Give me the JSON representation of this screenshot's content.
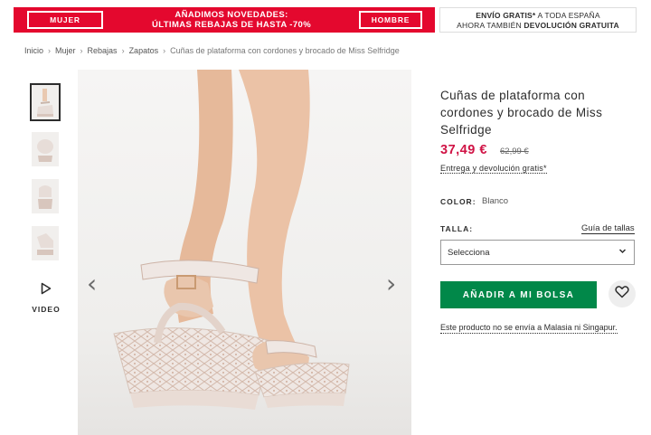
{
  "promo": {
    "women_label": "MUJER",
    "men_label": "HOMBRE",
    "line1": "AÑADIMOS NOVEDADES:",
    "line2": "ÚLTIMAS REBAJAS DE HASTA -70%",
    "color": "#e4082e"
  },
  "shipping": {
    "line1_bold": "ENVÍO GRATIS*",
    "line1_rest": " A TODA ESPAÑA",
    "line2_rest": "AHORA TAMBIÉN ",
    "line2_bold": "DEVOLUCIÓN GRATUITA"
  },
  "breadcrumb": {
    "items": [
      "Inicio",
      "Mujer",
      "Rebajas",
      "Zapatos"
    ],
    "current": "Cuñas de plataforma con cordones y brocado de Miss Selfridge",
    "separator": "›"
  },
  "gallery": {
    "video_label": "VIDEO",
    "play_icon": "play-icon",
    "prev_icon": "chevron-left-icon",
    "next_icon": "chevron-right-icon"
  },
  "product": {
    "title": "Cuñas de plataforma con cordones y brocado de Miss Selfridge",
    "price": "37,49 €",
    "old_price": "62,99 €",
    "price_color": "#d01345",
    "delivery": "Entrega y devolución gratis*",
    "color_label": "COLOR:",
    "color_value": "Blanco",
    "size_label": "TALLA:",
    "size_guide": "Guía de tallas",
    "size_select": "Selecciona",
    "add_button": "AÑADIR A MI BOLSA",
    "add_button_color": "#018849",
    "wishlist_icon": "heart-icon",
    "note": "Este producto no se envía a Malasia ni Singapur."
  }
}
